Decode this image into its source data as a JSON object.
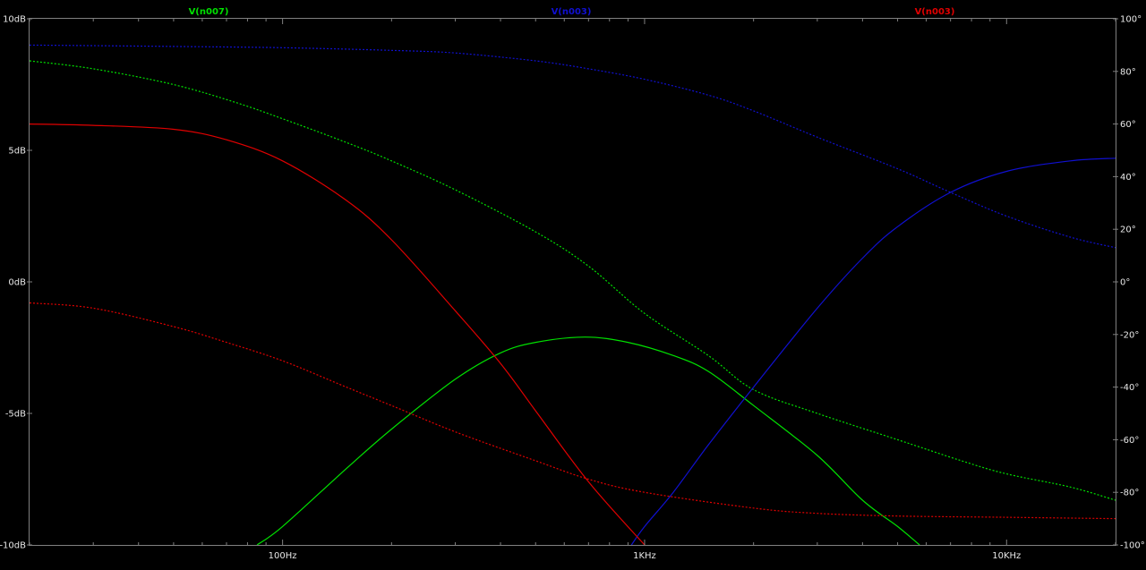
{
  "colors": {
    "background": "#000000",
    "frame": "#808080",
    "text": "#e8e8e8",
    "green": "#00e000",
    "blue": "#1010d0",
    "red": "#e00000"
  },
  "chart_data": {
    "type": "line",
    "x_scale": "log",
    "xlim": [
      20,
      20000
    ],
    "ylim_left": [
      -10,
      10
    ],
    "ylim_right": [
      -100,
      100
    ],
    "x_ticks": [
      {
        "value": 100,
        "label": "100Hz"
      },
      {
        "value": 1000,
        "label": "1KHz"
      },
      {
        "value": 10000,
        "label": "10KHz"
      }
    ],
    "y_ticks_left": [
      {
        "value": 10,
        "label": "10dB"
      },
      {
        "value": 5,
        "label": "5dB"
      },
      {
        "value": 0,
        "label": "0dB"
      },
      {
        "value": -5,
        "label": "-5dB"
      },
      {
        "value": -10,
        "label": "-10dB"
      }
    ],
    "y_ticks_right": [
      {
        "value": 100,
        "label": "100°"
      },
      {
        "value": 80,
        "label": "80°"
      },
      {
        "value": 60,
        "label": "60°"
      },
      {
        "value": 40,
        "label": "40°"
      },
      {
        "value": 20,
        "label": "20°"
      },
      {
        "value": 0,
        "label": "0°"
      },
      {
        "value": -20,
        "label": "-20°"
      },
      {
        "value": -40,
        "label": "-40°"
      },
      {
        "value": -60,
        "label": "-60°"
      },
      {
        "value": -80,
        "label": "-80°"
      },
      {
        "value": -100,
        "label": "-100°"
      }
    ],
    "legend": [
      {
        "label": "V(n007)",
        "color_key": "green"
      },
      {
        "label": "V(n003)",
        "color_key": "blue"
      },
      {
        "label": "V(n003)",
        "color_key": "red"
      }
    ],
    "series": [
      {
        "trace": "V(n007)",
        "kind": "magnitude",
        "axis": "left",
        "color_key": "green",
        "dash": false,
        "x": [
          85,
          100,
          150,
          200,
          300,
          400,
          500,
          684,
          900,
          1200,
          1500,
          2000,
          3000,
          4000,
          5000,
          5750
        ],
        "y": [
          -10,
          -9.3,
          -7.1,
          -5.6,
          -3.7,
          -2.7,
          -2.3,
          -2.1,
          -2.3,
          -2.8,
          -3.4,
          -4.7,
          -6.6,
          -8.3,
          -9.3,
          -10
        ]
      },
      {
        "trace": "V(n007)",
        "kind": "phase",
        "axis": "right",
        "color_key": "green",
        "dash": true,
        "x": [
          20,
          30,
          50,
          75,
          100,
          150,
          200,
          300,
          500,
          700,
          1000,
          1500,
          2000,
          3000,
          5000,
          7500,
          10000,
          15000,
          20000
        ],
        "y": [
          84,
          81,
          75,
          68,
          62,
          53,
          46,
          35,
          19,
          6,
          -12,
          -28,
          -41,
          -50,
          -60,
          -68,
          -73,
          -78,
          -83
        ]
      },
      {
        "trace": "V(n003)",
        "kind": "magnitude",
        "axis": "left",
        "color_key": "blue",
        "dash": false,
        "x": [
          920,
          1000,
          1200,
          1500,
          2000,
          3000,
          4000,
          5000,
          7000,
          10000,
          15000,
          20000
        ],
        "y": [
          -10,
          -9.3,
          -8,
          -6.2,
          -4,
          -1,
          0.9,
          2.1,
          3.4,
          4.2,
          4.6,
          4.7
        ]
      },
      {
        "trace": "V(n003)",
        "kind": "phase",
        "axis": "right",
        "color_key": "blue",
        "dash": true,
        "x": [
          20,
          50,
          100,
          200,
          300,
          500,
          700,
          1000,
          1500,
          2000,
          3000,
          5000,
          7000,
          10000,
          15000,
          20000
        ],
        "y": [
          90,
          89.5,
          89,
          88,
          87,
          84,
          81,
          77,
          71,
          65,
          55,
          43,
          34,
          25,
          17,
          13
        ]
      },
      {
        "trace": "V(n003)",
        "kind": "magnitude",
        "axis": "left",
        "color_key": "red",
        "dash": false,
        "x": [
          20,
          30,
          50,
          70,
          100,
          150,
          200,
          300,
          400,
          500,
          700,
          1000,
          1100
        ],
        "y": [
          6,
          5.95,
          5.8,
          5.4,
          4.6,
          3.1,
          1.6,
          -1.1,
          -3.1,
          -4.9,
          -7.6,
          -10,
          -10.6
        ]
      },
      {
        "trace": "V(n003)",
        "kind": "phase",
        "axis": "right",
        "color_key": "red",
        "dash": true,
        "x": [
          20,
          30,
          50,
          70,
          100,
          150,
          200,
          300,
          500,
          700,
          1000,
          2000,
          3000,
          5000,
          10000,
          20000
        ],
        "y": [
          -8,
          -10,
          -17,
          -23,
          -30,
          -40,
          -47,
          -57,
          -68,
          -75,
          -80,
          -86,
          -88,
          -89,
          -89.5,
          -90
        ]
      }
    ]
  }
}
